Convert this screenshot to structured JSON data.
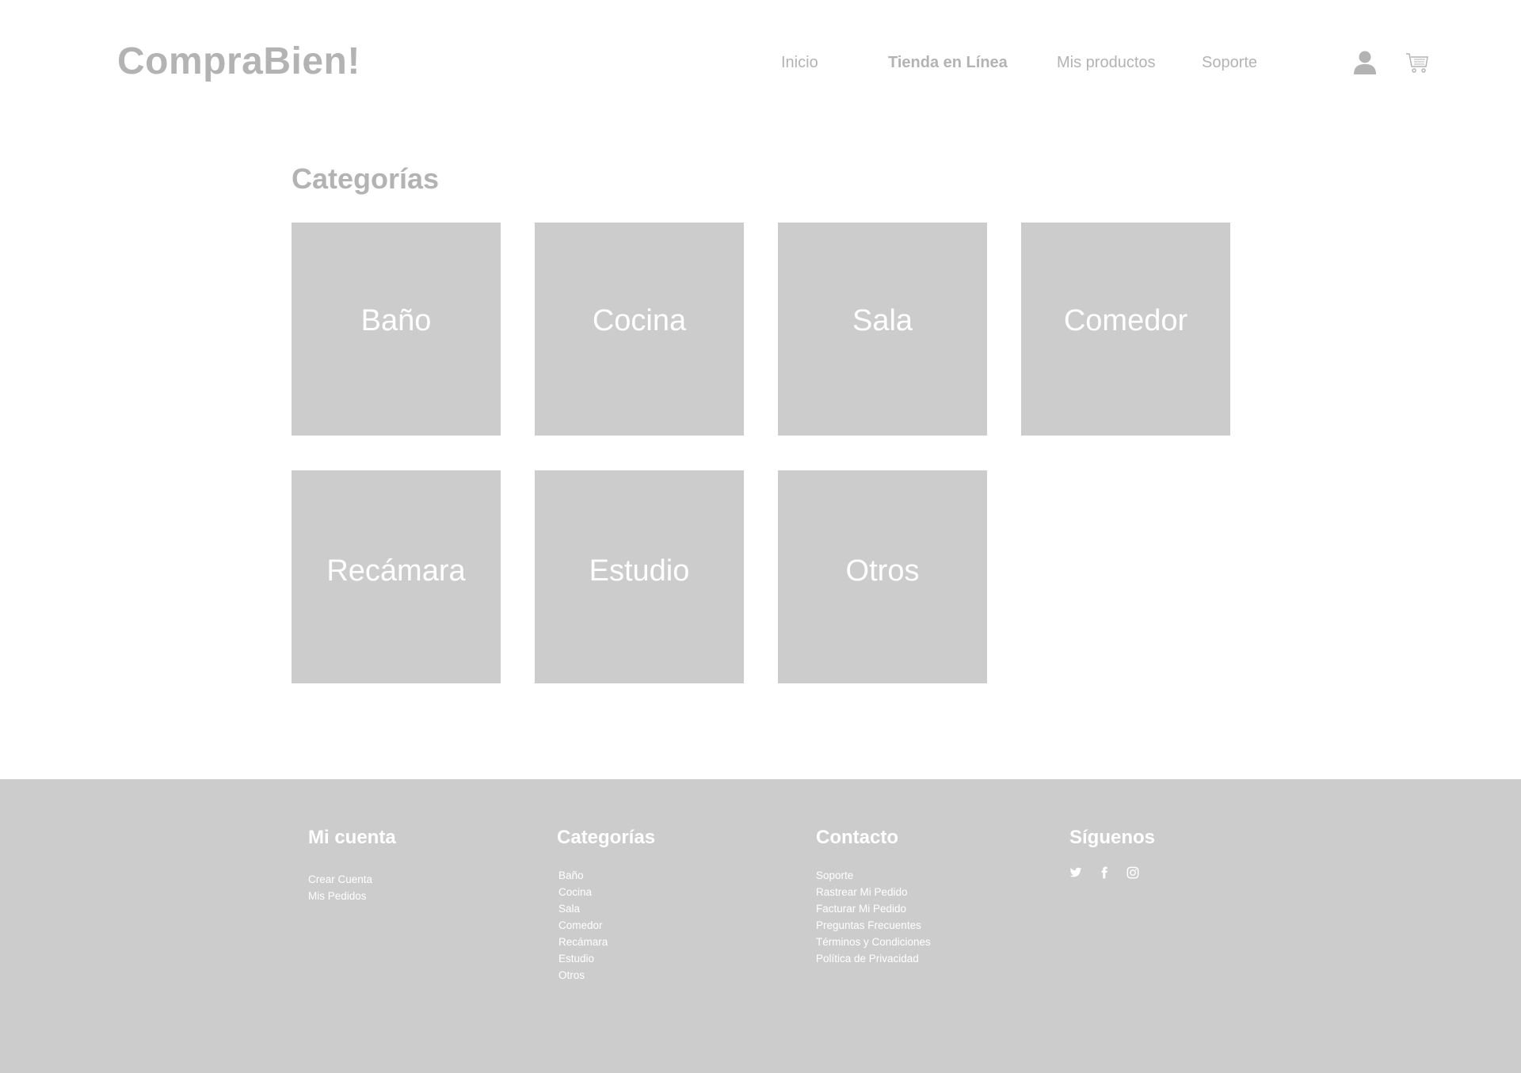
{
  "header": {
    "logo": "CompraBien!",
    "nav": [
      {
        "label": "Inicio",
        "active": false
      },
      {
        "label": "Tienda en Línea",
        "active": true
      },
      {
        "label": "Mis productos",
        "active": false
      },
      {
        "label": "Soporte",
        "active": false
      }
    ],
    "icons": [
      "user-icon",
      "cart-icon"
    ]
  },
  "main": {
    "title": "Categorías",
    "categories": [
      "Baño",
      "Cocina",
      "Sala",
      "Comedor",
      "Recámara",
      "Estudio",
      "Otros"
    ]
  },
  "footer": {
    "account": {
      "heading": "Mi cuenta",
      "links": [
        "Crear Cuenta",
        "Mis Pedidos"
      ]
    },
    "categories": {
      "heading": "Categorías",
      "links": [
        "Baño",
        "Cocina",
        "Sala",
        "Comedor",
        "Recámara",
        "Estudio",
        "Otros"
      ]
    },
    "contact": {
      "heading": "Contacto",
      "links": [
        "Soporte",
        "Rastrear Mi Pedido",
        "Facturar Mi Pedido",
        "Preguntas Frecuentes",
        "Términos y Condiciones",
        "Política de Privacidad"
      ]
    },
    "social": {
      "heading": "Síguenos",
      "icons": [
        "twitter-icon",
        "facebook-icon",
        "instagram-icon"
      ]
    }
  },
  "colors": {
    "text_gray": "#b3b3b3",
    "tile_gray": "#cccccc",
    "footer_bg": "#cccccc",
    "white": "#ffffff"
  }
}
